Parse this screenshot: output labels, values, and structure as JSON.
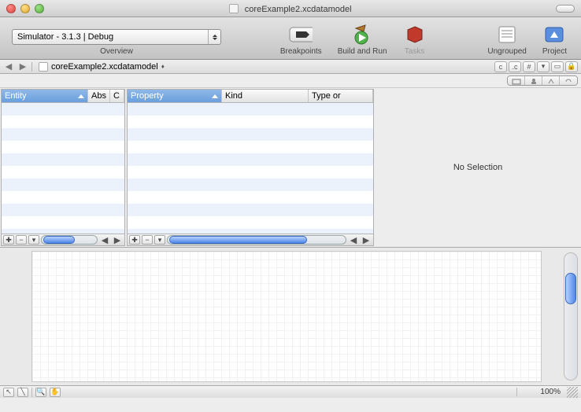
{
  "window": {
    "title": "coreExample2.xcdatamodel"
  },
  "toolbar": {
    "overview_label": "Overview",
    "active_sdk": "Simulator - 3.1.3 | Debug",
    "breakpoints": "Breakpoints",
    "build_and_run": "Build and Run",
    "tasks": "Tasks",
    "ungrouped": "Ungrouped",
    "project": "Project"
  },
  "pathbar": {
    "file": "coreExample2.xcdatamodel"
  },
  "left_pane": {
    "columns": {
      "entity": "Entity",
      "abs": "Abs",
      "c": "C"
    }
  },
  "mid_pane": {
    "columns": {
      "property": "Property",
      "kind": "Kind",
      "type_or": "Type or"
    }
  },
  "right_pane": {
    "no_selection": "No Selection"
  },
  "status": {
    "zoom": "100%"
  }
}
